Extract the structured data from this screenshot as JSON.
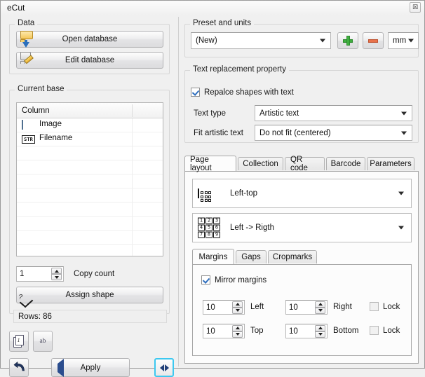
{
  "window": {
    "title": "eCut",
    "close_label": "☒"
  },
  "left": {
    "data_group": {
      "title": "Data",
      "open_database": "Open database",
      "edit_database": "Edit database"
    },
    "current_base": {
      "title": "Current base",
      "column_header": "Column",
      "rows": [
        {
          "icon": "image-icon",
          "label": "Image"
        },
        {
          "icon": "string-type-icon",
          "label": "Filename"
        }
      ]
    },
    "copy_count": {
      "value": "1",
      "label": "Copy count"
    },
    "assign_shape": "Assign shape",
    "status": "Rows: 86",
    "tool_buttons": [
      {
        "name": "page-number-button",
        "glyph": "1"
      },
      {
        "name": "text-tool-button",
        "glyph": "ab"
      }
    ],
    "undo_label": "",
    "apply_label": "Apply",
    "expand_label": ""
  },
  "right": {
    "preset_group": {
      "title": "Preset and units",
      "preset_value": "(New)",
      "add_label": "+",
      "remove_label": "−",
      "units_value": "mm"
    },
    "text_replacement": {
      "title": "Text replacement property",
      "replace_checkbox": "Repalce shapes with text",
      "replace_checked": true,
      "text_type_label": "Text type",
      "text_type_value": "Artistic text",
      "fit_label": "Fit artistic text",
      "fit_value": "Do not fit (centered)"
    },
    "tabs": [
      {
        "label": "Page layout",
        "active": true
      },
      {
        "label": "Collection",
        "active": false
      },
      {
        "label": "QR code",
        "active": false
      },
      {
        "label": "Barcode",
        "active": false
      },
      {
        "label": "Parameters",
        "active": false
      }
    ],
    "page_layout": {
      "start_corner_value": "Left-top",
      "order_value": "Left -> Rigth",
      "order_cells": [
        "1",
        "2",
        "3",
        "4",
        "5",
        "6",
        "7",
        "8",
        "9"
      ],
      "subtabs": [
        {
          "label": "Margins",
          "active": true
        },
        {
          "label": "Gaps",
          "active": false
        },
        {
          "label": "Cropmarks",
          "active": false
        }
      ],
      "margins": {
        "mirror_label": "Mirror margins",
        "mirror_checked": true,
        "left_value": "10",
        "left_label": "Left",
        "right_value": "10",
        "right_label": "Right",
        "lock_top_label": "Lock",
        "top_value": "10",
        "top_label": "Top",
        "bottom_value": "10",
        "bottom_label": "Bottom",
        "lock_bottom_label": "Lock"
      }
    }
  },
  "colors": {
    "accent_cyan": "#3cc8f0",
    "apply_arrow": "#2b4d8e",
    "plus_green": "#3fae3f",
    "minus_red": "#e8714a"
  }
}
